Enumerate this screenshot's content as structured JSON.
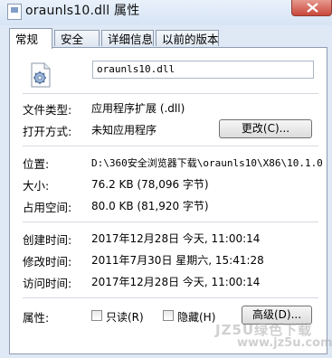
{
  "window": {
    "title": "oraunls10.dll 属性"
  },
  "tabs": [
    {
      "label": "常规",
      "active": true
    },
    {
      "label": "安全",
      "active": false
    },
    {
      "label": "详细信息",
      "active": false
    },
    {
      "label": "以前的版本",
      "active": false
    }
  ],
  "general": {
    "file_name": "oraunls10.dll",
    "file_type_label": "文件类型:",
    "file_type_value": "应用程序扩展 (.dll)",
    "open_with_label": "打开方式:",
    "open_with_value": "未知应用程序",
    "change_button": "更改(C)...",
    "location_label": "位置:",
    "location_value": "D:\\360安全浏览器下载\\oraunls10\\X86\\10.1.0",
    "size_label": "大小:",
    "size_value": "76.2 KB (78,096 字节)",
    "size_on_disk_label": "占用空间:",
    "size_on_disk_value": "80.0 KB (81,920 字节)",
    "created_label": "创建时间:",
    "created_value": "2017年12月28日 今天, 11:00:14",
    "modified_label": "修改时间:",
    "modified_value": "2011年7月30日 星期六, 15:41:28",
    "accessed_label": "访问时间:",
    "accessed_value": "2017年12月28日 今天, 11:00:14",
    "attributes_label": "属性:",
    "readonly_label": "只读(R)",
    "hidden_label": "隐藏(H)",
    "advanced_button": "高级(D)..."
  },
  "watermark": {
    "line1": "JZ5U绿色下载",
    "line2": "www.jz5u.com"
  },
  "colors": {
    "close_button": "#c9473a",
    "panel_bg": "#ffffff",
    "window_bg": "#dfe9f5"
  },
  "icons": {
    "file": "dll-gear-icon",
    "close": "close-icon",
    "title": "document-icon"
  }
}
